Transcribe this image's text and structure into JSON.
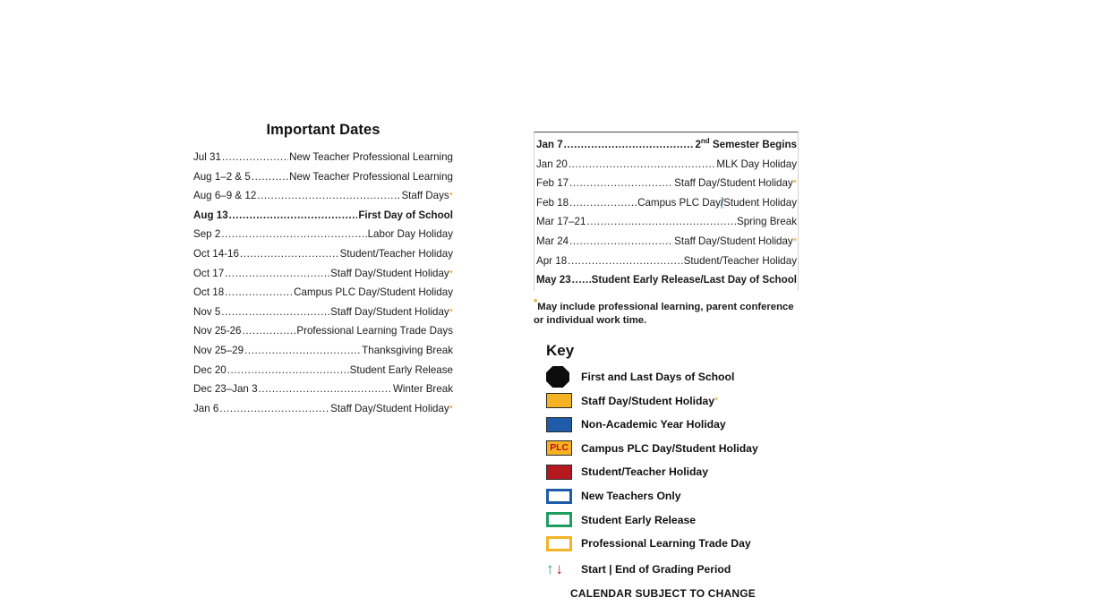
{
  "left": {
    "title": "Important Dates",
    "rows": [
      {
        "label": "Jul 31",
        "desc": "New Teacher Professional Learning",
        "bold": false,
        "star": false
      },
      {
        "label": "Aug 1–2 & 5",
        "desc": "New Teacher Professional Learning",
        "bold": false,
        "star": false
      },
      {
        "label": "Aug 6–9 & 12",
        "desc": "Staff Days",
        "bold": false,
        "star": true
      },
      {
        "label": "Aug 13",
        "desc": "First Day of School",
        "bold": true,
        "star": false
      },
      {
        "label": "Sep 2",
        "desc": "Labor Day Holiday",
        "bold": false,
        "star": false
      },
      {
        "label": "Oct 14-16",
        "desc": "Student/Teacher Holiday",
        "bold": false,
        "star": false
      },
      {
        "label": "Oct 17",
        "desc": "Staff Day/Student Holiday",
        "bold": false,
        "star": true
      },
      {
        "label": "Oct 18",
        "desc": "Campus PLC Day/Student Holiday",
        "bold": false,
        "star": false
      },
      {
        "label": "Nov 5",
        "desc": "Staff Day/Student Holiday",
        "bold": false,
        "star": true
      },
      {
        "label": "Nov 25-26",
        "desc": "Professional Learning Trade Days",
        "bold": false,
        "star": false
      },
      {
        "label": "Nov 25–29",
        "desc": "Thanksgiving Break",
        "bold": false,
        "star": false
      },
      {
        "label": "Dec 20",
        "desc": "Student Early Release",
        "bold": false,
        "star": false
      },
      {
        "label": "Dec 23–Jan 3",
        "desc": "Winter Break",
        "bold": false,
        "star": false
      },
      {
        "label": "Jan 6",
        "desc": "Staff Day/Student Holiday",
        "bold": false,
        "star": true
      }
    ]
  },
  "right": {
    "rows": [
      {
        "label": "Jan 7",
        "desc": "2nd Semester Begins",
        "bold": true,
        "star": false,
        "sup": "nd"
      },
      {
        "label": "Jan 20",
        "desc": "MLK Day Holiday",
        "bold": false,
        "star": false
      },
      {
        "label": "Feb 17",
        "desc": "Staff Day/Student Holiday",
        "bold": false,
        "star": true
      },
      {
        "label": "Feb 18",
        "desc": "Campus PLC Day/Student Holiday",
        "bold": false,
        "star": false,
        "selection": "/"
      },
      {
        "label": "Mar 17–21",
        "desc": "Spring Break",
        "bold": false,
        "star": false
      },
      {
        "label": "Mar 24",
        "desc": "Staff Day/Student Holiday",
        "bold": false,
        "star": true
      },
      {
        "label": "Apr 18",
        "desc": "Student/Teacher Holiday",
        "bold": false,
        "star": false
      },
      {
        "label": "May 23",
        "desc": "Student Early Release/Last Day of School",
        "bold": true,
        "star": false
      }
    ],
    "footnote": "May include professional learning, parent conference or individual work time.",
    "footnote_star": "*"
  },
  "key": {
    "heading": "Key",
    "items": [
      {
        "label": "First and Last Days of School",
        "swatch": "octagon-black",
        "color": "#0d0d0d",
        "star": false
      },
      {
        "label": "Staff Day/Student Holiday",
        "swatch": "filled-gold",
        "color": "#F5B324",
        "star": true
      },
      {
        "label": "Non-Academic Year Holiday",
        "swatch": "filled-blue",
        "color": "#1F5BA8",
        "star": false
      },
      {
        "label": "Campus PLC Day/Student Holiday",
        "swatch": "plc-box",
        "color": "#F5B324",
        "text": "PLC",
        "star": false
      },
      {
        "label": "Student/Teacher Holiday",
        "swatch": "filled-red",
        "color": "#B5191F",
        "star": false
      },
      {
        "label": "New Teachers Only",
        "swatch": "outline-blue",
        "color": "#1F5BA8",
        "star": false
      },
      {
        "label": "Student Early Release",
        "swatch": "outline-green",
        "color": "#1E9E5E",
        "star": false
      },
      {
        "label": "Professional Learning Trade Day",
        "swatch": "outline-gold",
        "color": "#F5B324",
        "star": false
      }
    ],
    "grading": {
      "arrow_up": "↑",
      "arrow_down": "↓",
      "label": "Start | End of Grading Period",
      "up_color": "#1E9E5E",
      "down_color": "#C0121A"
    },
    "calendar_note": "CALENDAR SUBJECT TO CHANGE"
  },
  "leader_dots": "................................................................................................."
}
